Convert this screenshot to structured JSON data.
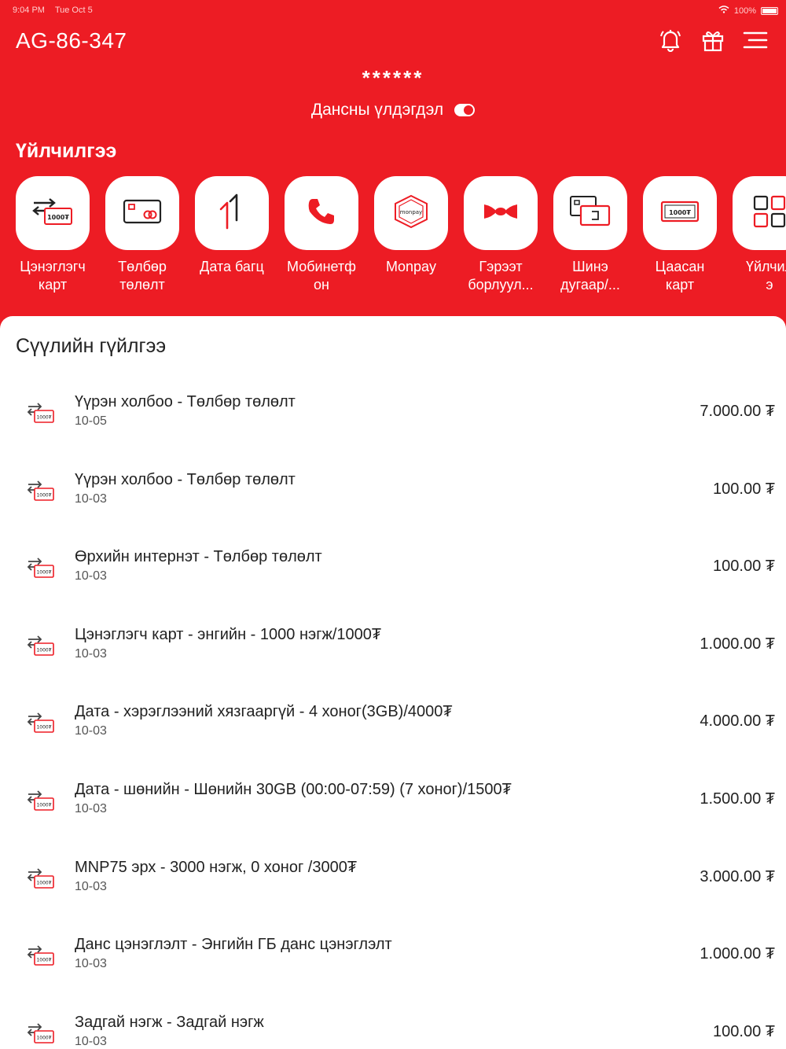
{
  "status_bar": {
    "time": "9:04 PM",
    "date": "Tue Oct 5",
    "battery": "100%"
  },
  "header": {
    "account_id": "AG-86-347",
    "icons": [
      "bell-icon",
      "gift-icon",
      "menu-icon"
    ]
  },
  "balance": {
    "masked": "******",
    "label": "Дансны үлдэгдэл"
  },
  "services": {
    "title": "Үйлчилгээ",
    "items": [
      {
        "label": "Цэнэглэгч\nкарт",
        "icon": "recharge-card-icon"
      },
      {
        "label": "Төлбөр\nтөлөлт",
        "icon": "payment-card-icon"
      },
      {
        "label": "Дата багц",
        "icon": "data-transfer-icon"
      },
      {
        "label": "Мобинетф\nон",
        "icon": "phone-icon"
      },
      {
        "label": "Monpay",
        "icon": "monpay-icon"
      },
      {
        "label": "Гэрээт\nборлуул...",
        "icon": "contract-sales-icon"
      },
      {
        "label": "Шинэ\nдугаар/...",
        "icon": "new-number-icon"
      },
      {
        "label": "Цаасан\nкарт",
        "icon": "paper-card-icon"
      },
      {
        "label": "Үйлчил\nэ",
        "icon": "services-grid-icon"
      }
    ]
  },
  "recent": {
    "title": "Сүүлийн гүйлгээ",
    "transactions": [
      {
        "title": "Үүрэн холбоо - Төлбөр төлөлт",
        "date": "10-05",
        "amount": "7.000.00 ₮"
      },
      {
        "title": "Үүрэн холбоо - Төлбөр төлөлт",
        "date": "10-03",
        "amount": "100.00 ₮"
      },
      {
        "title": "Өрхийн интернэт - Төлбөр төлөлт",
        "date": "10-03",
        "amount": "100.00 ₮"
      },
      {
        "title": "Цэнэглэгч карт - энгийн - 1000 нэгж/1000₮",
        "date": "10-03",
        "amount": "1.000.00 ₮"
      },
      {
        "title": "Дата - хэрэглээний хязгааргүй - 4 хоног(3GB)/4000₮",
        "date": "10-03",
        "amount": "4.000.00 ₮"
      },
      {
        "title": "Дата - шөнийн - Шөнийн 30GB (00:00-07:59) (7 хоног)/1500₮",
        "date": "10-03",
        "amount": "1.500.00 ₮"
      },
      {
        "title": "MNP75 эрх - 3000 нэгж, 0 хоног /3000₮",
        "date": "10-03",
        "amount": "3.000.00 ₮"
      },
      {
        "title": "Данс цэнэглэлт - Энгийн ГБ данс цэнэглэлт",
        "date": "10-03",
        "amount": "1.000.00 ₮"
      },
      {
        "title": "Задгай нэгж - Задгай нэгж",
        "date": "10-03",
        "amount": "100.00 ₮"
      }
    ]
  },
  "colors": {
    "brand_red": "#ed1c24",
    "panel_bg": "#ffffff",
    "text_dark": "#222222"
  }
}
